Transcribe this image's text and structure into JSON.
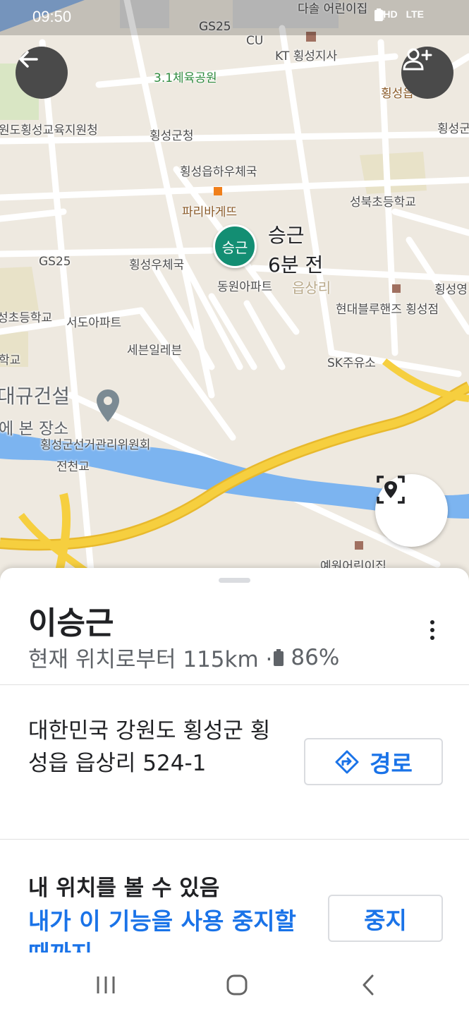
{
  "status_bar": {
    "time": "09:50",
    "icons": [
      "location-icon",
      "hd-voice-icon",
      "lte-icon",
      "signal-icon",
      "battery-icon"
    ],
    "hd": "HD",
    "lte": "LTE"
  },
  "map": {
    "labels": {
      "dasol": "다솔 어린이집",
      "gs25_top": "GS25",
      "cu": "CU",
      "kt": "KT 횡성지사",
      "park": "3.1체육공원",
      "hoengseong_eup": "횡성읍",
      "hoengseong_right": "횡성군",
      "education": "원도횡성교육지원청",
      "county_office": "횡성군청",
      "post_eupha": "횡성읍하우체국",
      "paris": "파리바게뜨",
      "seongbuk": "성북초등학교",
      "gs25_left": "GS25",
      "post": "횡성우체국",
      "dongwon": "동원아파트",
      "eupsang": "읍상리",
      "hoengseongyeong": "횡성영",
      "hyundai": "현대블루핸즈 횡성점",
      "elem_left": "성초등학교",
      "seodo": "서도아파트",
      "seven": "세븐일레븐",
      "sk": "SK주유소",
      "school_left": "학교",
      "daegyu": "대규건설",
      "saved_place": "에 본 장소",
      "election": "횡성군선거관리위원회",
      "jeoncheon": "전천교",
      "yewon": "예원어린이집"
    },
    "marker": {
      "initials": "승근",
      "name": "승근",
      "time_ago": "6분 전"
    }
  },
  "sheet": {
    "name": "이승근",
    "distance": "현재 위치로부터 115km ·",
    "battery": "86%",
    "address": "대한민국 강원도 횡성군 횡성읍 읍상리 524-1",
    "route_label": "경로",
    "share_title": "내 위치를 볼 수 있음",
    "share_sub": "내가 이 기능을 사용 중지할 때까지",
    "stop_label": "중지"
  },
  "colors": {
    "accent": "#1a73e8",
    "marker": "#138e73",
    "road_major": "#f6cf3f",
    "water": "#7cb4f0"
  }
}
